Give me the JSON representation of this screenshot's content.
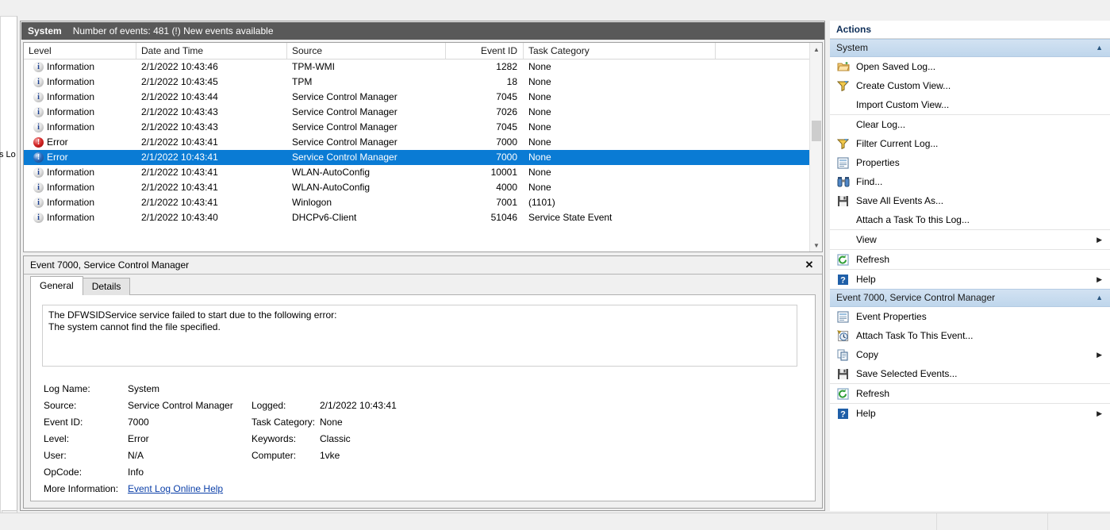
{
  "left_panel": {
    "clipped_label": "s Lo",
    "expander_glyph": "≫"
  },
  "log": {
    "name": "System",
    "count_text": "Number of events: 481 (!) New events available"
  },
  "columns": [
    {
      "label": "Level"
    },
    {
      "label": "Date and Time"
    },
    {
      "label": "Source"
    },
    {
      "label": "Event ID"
    },
    {
      "label": "Task Category"
    }
  ],
  "rows": [
    {
      "level": "Information",
      "icon": "info-icon",
      "datetime": "2/1/2022 10:43:46",
      "source": "TPM-WMI",
      "event_id": "1282",
      "task_category": "None",
      "selected": false
    },
    {
      "level": "Information",
      "icon": "info-icon",
      "datetime": "2/1/2022 10:43:45",
      "source": "TPM",
      "event_id": "18",
      "task_category": "None",
      "selected": false
    },
    {
      "level": "Information",
      "icon": "info-icon",
      "datetime": "2/1/2022 10:43:44",
      "source": "Service Control Manager",
      "event_id": "7045",
      "task_category": "None",
      "selected": false
    },
    {
      "level": "Information",
      "icon": "info-icon",
      "datetime": "2/1/2022 10:43:43",
      "source": "Service Control Manager",
      "event_id": "7026",
      "task_category": "None",
      "selected": false
    },
    {
      "level": "Information",
      "icon": "info-icon",
      "datetime": "2/1/2022 10:43:43",
      "source": "Service Control Manager",
      "event_id": "7045",
      "task_category": "None",
      "selected": false
    },
    {
      "level": "Error",
      "icon": "error-icon",
      "datetime": "2/1/2022 10:43:41",
      "source": "Service Control Manager",
      "event_id": "7000",
      "task_category": "None",
      "selected": false
    },
    {
      "level": "Error",
      "icon": "error-icon",
      "datetime": "2/1/2022 10:43:41",
      "source": "Service Control Manager",
      "event_id": "7000",
      "task_category": "None",
      "selected": true
    },
    {
      "level": "Information",
      "icon": "info-icon",
      "datetime": "2/1/2022 10:43:41",
      "source": "WLAN-AutoConfig",
      "event_id": "10001",
      "task_category": "None",
      "selected": false
    },
    {
      "level": "Information",
      "icon": "info-icon",
      "datetime": "2/1/2022 10:43:41",
      "source": "WLAN-AutoConfig",
      "event_id": "4000",
      "task_category": "None",
      "selected": false
    },
    {
      "level": "Information",
      "icon": "info-icon",
      "datetime": "2/1/2022 10:43:41",
      "source": "Winlogon",
      "event_id": "7001",
      "task_category": "(1101)",
      "selected": false
    },
    {
      "level": "Information",
      "icon": "info-icon",
      "datetime": "2/1/2022 10:43:40",
      "source": "DHCPv6-Client",
      "event_id": "51046",
      "task_category": "Service State Event",
      "selected": false
    }
  ],
  "details": {
    "title": "Event 7000, Service Control Manager",
    "close_glyph": "✕",
    "tabs": [
      {
        "label": "General",
        "active": true
      },
      {
        "label": "Details",
        "active": false
      }
    ],
    "description_line1": "The DFWSIDService service failed to start due to the following error:",
    "description_line2": "The system cannot find the file specified.",
    "fields": {
      "log_name_label": "Log Name:",
      "log_name_value": "System",
      "source_label": "Source:",
      "source_value": "Service Control Manager",
      "event_id_label": "Event ID:",
      "event_id_value": "7000",
      "level_label": "Level:",
      "level_value": "Error",
      "user_label": "User:",
      "user_value": "N/A",
      "opcode_label": "OpCode:",
      "opcode_value": "Info",
      "more_info_label": "More Information:",
      "more_info_link": "Event Log Online Help",
      "logged_label": "Logged:",
      "logged_value": "2/1/2022 10:43:41",
      "task_category_label": "Task Category:",
      "task_category_value": "None",
      "keywords_label": "Keywords:",
      "keywords_value": "Classic",
      "computer_label": "Computer:",
      "computer_value": "1vke"
    }
  },
  "actions": {
    "title": "Actions",
    "collapse_glyph": "▲",
    "submenu_glyph": "▶",
    "groups": [
      {
        "header": "System",
        "items": [
          {
            "label": "Open Saved Log...",
            "icon": "open-folder-icon",
            "separator": false,
            "submenu": false
          },
          {
            "label": "Create Custom View...",
            "icon": "filter-icon",
            "separator": false,
            "submenu": false
          },
          {
            "label": "Import Custom View...",
            "icon": "none",
            "separator": false,
            "submenu": false
          },
          {
            "label": "Clear Log...",
            "icon": "none",
            "separator": true,
            "submenu": false
          },
          {
            "label": "Filter Current Log...",
            "icon": "filter-icon",
            "separator": false,
            "submenu": false
          },
          {
            "label": "Properties",
            "icon": "properties-icon",
            "separator": false,
            "submenu": false
          },
          {
            "label": "Find...",
            "icon": "binoculars-icon",
            "separator": false,
            "submenu": false
          },
          {
            "label": "Save All Events As...",
            "icon": "save-icon",
            "separator": false,
            "submenu": false
          },
          {
            "label": "Attach a Task To this Log...",
            "icon": "none",
            "separator": false,
            "submenu": false
          },
          {
            "label": "View",
            "icon": "none",
            "separator": true,
            "submenu": true
          },
          {
            "label": "Refresh",
            "icon": "refresh-icon",
            "separator": true,
            "submenu": false
          },
          {
            "label": "Help",
            "icon": "help-icon",
            "separator": true,
            "submenu": true
          }
        ]
      },
      {
        "header": "Event 7000, Service Control Manager",
        "items": [
          {
            "label": "Event Properties",
            "icon": "properties-icon",
            "separator": false,
            "submenu": false
          },
          {
            "label": "Attach Task To This Event...",
            "icon": "attach-task-icon",
            "separator": false,
            "submenu": false
          },
          {
            "label": "Copy",
            "icon": "copy-icon",
            "separator": false,
            "submenu": true
          },
          {
            "label": "Save Selected Events...",
            "icon": "save-icon",
            "separator": false,
            "submenu": false
          },
          {
            "label": "Refresh",
            "icon": "refresh-icon",
            "separator": true,
            "submenu": false
          },
          {
            "label": "Help",
            "icon": "help-icon",
            "separator": true,
            "submenu": true
          }
        ]
      }
    ]
  }
}
